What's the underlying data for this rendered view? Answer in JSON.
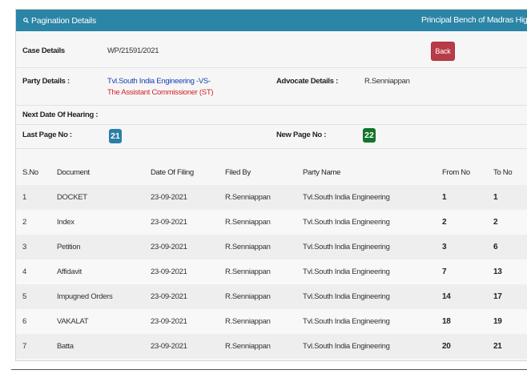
{
  "header": {
    "title": "Pagination Details",
    "right_text": "Principal Bench of Madras High Court"
  },
  "case_details": {
    "label": "Case Details",
    "value": "WP/21591/2021",
    "back_label": "Back"
  },
  "party_details": {
    "label": "Party Details :",
    "party_line1": "Tvl.South India Engineering -VS-",
    "party_line2": "The Assistant Commissioner (ST)",
    "advocate_label": "Advocate Details :",
    "advocate_value": "R.Senniappan"
  },
  "next_hearing": {
    "label": "Next Date Of Hearing :",
    "value": ""
  },
  "pages": {
    "last_label": "Last Page No :",
    "last_value": "21",
    "new_label": "New Page No :",
    "new_value": "22"
  },
  "table": {
    "headers": [
      "S.No",
      "Document",
      "Date Of Filing",
      "Filed By",
      "Party Name",
      "From No",
      "To No"
    ],
    "rows": [
      [
        "1",
        "DOCKET",
        "23-09-2021",
        "R.Senniappan",
        "Tvl.South India Engineering",
        "1",
        "1"
      ],
      [
        "2",
        "Index",
        "23-09-2021",
        "R.Senniappan",
        "Tvl.South India Engineering",
        "2",
        "2"
      ],
      [
        "3",
        "Petition",
        "23-09-2021",
        "R.Senniappan",
        "Tvl.South India Engineering",
        "3",
        "6"
      ],
      [
        "4",
        "Affidavit",
        "23-09-2021",
        "R.Senniappan",
        "Tvl.South India Engineering",
        "7",
        "13"
      ],
      [
        "5",
        "Impugned Orders",
        "23-09-2021",
        "R.Senniappan",
        "Tvl.South India Engineering",
        "14",
        "17"
      ],
      [
        "6",
        "VAKALAT",
        "23-09-2021",
        "R.Senniappan",
        "Tvl.South India Engineering",
        "18",
        "19"
      ],
      [
        "7",
        "Batta",
        "23-09-2021",
        "R.Senniappan",
        "Tvl.South India Engineering",
        "20",
        "21"
      ]
    ]
  },
  "colors": {
    "header_bg": "#2b85a6",
    "back_button": "#b83c47",
    "last_page_badge": "#2b7fa6",
    "new_page_badge": "#12752a",
    "party_link": "#1a3fb0",
    "respondent_text": "#d2232a"
  },
  "icons": {
    "header_icon": "search-icon"
  }
}
